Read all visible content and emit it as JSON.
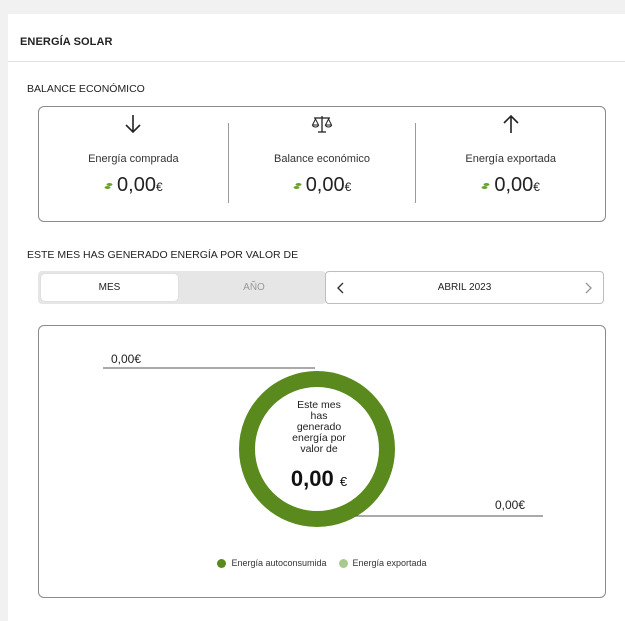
{
  "header": {
    "title": "ENERGÍA SOLAR"
  },
  "balance": {
    "title": "BALANCE ECONÓMICO",
    "items": [
      {
        "label": "Energía comprada",
        "value": "0,00",
        "currency": "€",
        "icon": "arrow-down-icon"
      },
      {
        "label": "Balance económico",
        "value": "0,00",
        "currency": "€",
        "icon": "scale-icon"
      },
      {
        "label": "Energía exportada",
        "value": "0,00",
        "currency": "€",
        "icon": "arrow-up-icon"
      }
    ]
  },
  "generated": {
    "title": "ESTE MES HAS GENERADO ENERGÍA POR VALOR DE",
    "toggle": {
      "active": "MES",
      "inactive": "AÑO"
    },
    "period": "ABRIL 2023"
  },
  "donut": {
    "top_amount": "0,00€",
    "bottom_amount": "0,00€",
    "center_lines": [
      "Este mes",
      "has",
      "generado",
      "energía por",
      "valor de"
    ],
    "center_value": "0,00",
    "center_currency": "€",
    "legend": [
      {
        "name": "Energía autoconsumida",
        "color": "#5a8a1d"
      },
      {
        "name": "Energía exportada",
        "color": "#a9c98d"
      }
    ]
  },
  "colors": {
    "accent_green": "#5a8a1d",
    "light_green": "#a9c98d",
    "coin_green": "#6aa32b"
  }
}
